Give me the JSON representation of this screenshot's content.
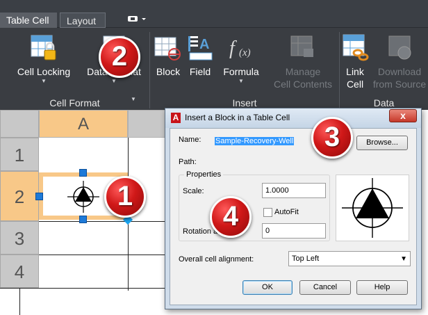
{
  "tabs": [
    {
      "label": "Table Cell"
    },
    {
      "label": "Layout"
    }
  ],
  "ribbon": {
    "cell_format_panel": {
      "label": "Cell Format",
      "buttons": [
        {
          "label": "Cell Locking",
          "icon": "cell-locking-icon"
        },
        {
          "label": "Data Format",
          "icon": "data-format-icon"
        }
      ]
    },
    "insert_panel": {
      "label": "Insert",
      "buttons": [
        {
          "label": "Block",
          "icon": "block-icon"
        },
        {
          "label": "Field",
          "icon": "field-icon"
        },
        {
          "label": "Formula",
          "icon": "formula-icon"
        },
        {
          "label_line1": "Manage",
          "label_line2": "Cell Contents",
          "icon": "manage-cell-contents-icon",
          "disabled": true
        }
      ]
    },
    "data_panel": {
      "label": "Data",
      "buttons": [
        {
          "label_line1": "Link",
          "label_line2": "Cell",
          "icon": "link-cell-icon"
        },
        {
          "label_line1": "Download",
          "label_line2": "from Source",
          "icon": "download-from-source-icon",
          "disabled": true
        }
      ]
    }
  },
  "sheet": {
    "column_headers": [
      "A"
    ],
    "row_headers": [
      "1",
      "2",
      "3",
      "4"
    ],
    "selected_row": "2",
    "selected_column": "A"
  },
  "badges": [
    "1",
    "2",
    "3",
    "4"
  ],
  "dialog": {
    "title": "Insert a Block in a Table Cell",
    "close_label": "x",
    "name_label": "Name:",
    "name_value": "Sample-Recovery-Well",
    "browse_label": "Browse...",
    "path_label": "Path:",
    "properties_label": "Properties",
    "scale_label": "Scale:",
    "scale_value": "1.0000",
    "autofit_label": "AutoFit",
    "autofit_checked": false,
    "rotation_label": "Rotation angle:",
    "rotation_value": "0",
    "alignment_label": "Overall cell alignment:",
    "alignment_value": "Top Left",
    "ok_label": "OK",
    "cancel_label": "Cancel",
    "help_label": "Help"
  },
  "colors": {
    "ribbon_bg": "#3a3d42",
    "selection_orange": "#f8c888",
    "grip_blue": "#1e7ad8",
    "badge_red": "#d01818",
    "dialog_frame": "#cfdcea"
  }
}
